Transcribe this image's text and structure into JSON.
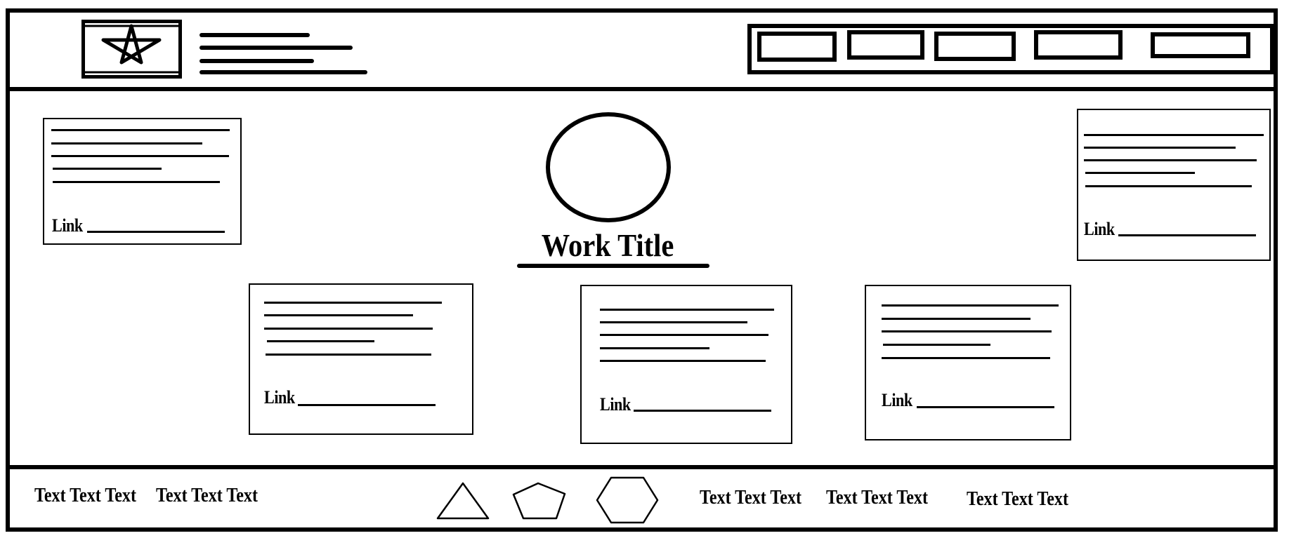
{
  "main": {
    "title": "Work Title",
    "cards": [
      {
        "link": "Link"
      },
      {
        "link": "Link"
      },
      {
        "link": "Link"
      },
      {
        "link": "Link"
      },
      {
        "link": "Link"
      }
    ]
  },
  "footer": {
    "left_texts": [
      "Text Text Text",
      "Text Text Text"
    ],
    "right_texts": [
      "Text Text Text",
      "Text Text Text",
      "Text Text Text"
    ],
    "icons": [
      "triangle-icon",
      "pentagon-icon",
      "hexagon-icon"
    ]
  },
  "header": {
    "logo_icon": "image-placeholder-star-icon",
    "nav_item_count_note": ""
  }
}
